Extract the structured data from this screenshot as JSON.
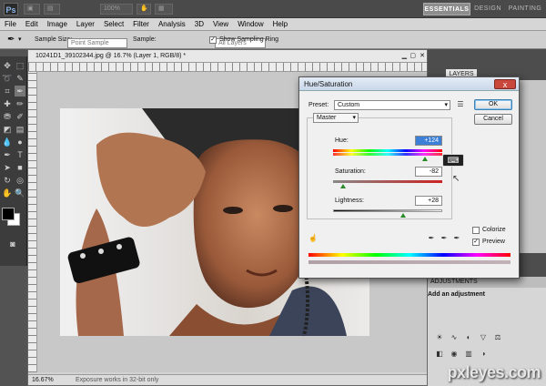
{
  "app": {
    "logo": "Ps",
    "zoom": "100%",
    "workspaces": [
      {
        "label": "ESSENTIALS",
        "active": true
      },
      {
        "label": "DESIGN",
        "active": false
      },
      {
        "label": "PAINTING",
        "active": false
      }
    ]
  },
  "menubar": [
    "File",
    "Edit",
    "Image",
    "Layer",
    "Select",
    "Filter",
    "Analysis",
    "3D",
    "View",
    "Window",
    "Help"
  ],
  "options": {
    "sample_size_label": "Sample Size:",
    "sample_size_value": "Point Sample",
    "sample_label": "Sample:",
    "sample_value": "All Layers",
    "show_ring_label": "Show Sampling Ring",
    "show_ring_checked": true
  },
  "document": {
    "title": "10241D1_39102344.jpg @ 16.7% (Layer 1, RGB/8) *",
    "zoom": "16.67%",
    "status": "Exposure works in 32-bit only"
  },
  "panels": {
    "layers_label": "LAYERS",
    "adjustments_title": "ADJUSTMENTS",
    "adjustments_subtitle": "Add an adjustment"
  },
  "hue_saturation": {
    "title": "Hue/Saturation",
    "close_label": "x",
    "preset_label": "Preset:",
    "preset_value": "Custom",
    "channel": "Master",
    "hue_label": "Hue:",
    "hue_value": "+124",
    "saturation_label": "Saturation:",
    "saturation_value": "-82",
    "lightness_label": "Lightness:",
    "lightness_value": "+28",
    "ok_label": "OK",
    "cancel_label": "Cancel",
    "colorize_label": "Colorize",
    "colorize_checked": false,
    "preview_label": "Preview",
    "preview_checked": true,
    "hue_level": 0.84,
    "saturation_level": 0.09,
    "lightness_level": 0.64
  },
  "watermark": "pxleyes.com"
}
